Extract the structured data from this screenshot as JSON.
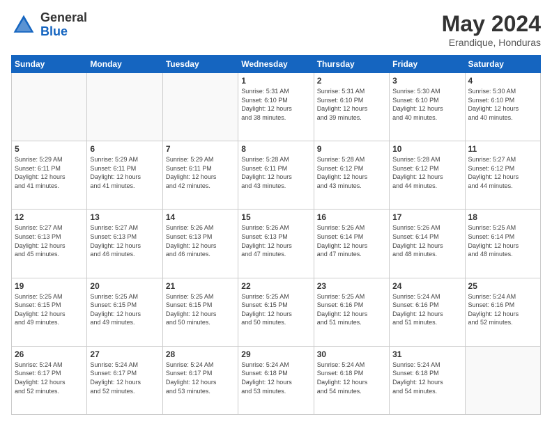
{
  "header": {
    "logo_general": "General",
    "logo_blue": "Blue",
    "month_title": "May 2024",
    "location": "Erandique, Honduras"
  },
  "weekdays": [
    "Sunday",
    "Monday",
    "Tuesday",
    "Wednesday",
    "Thursday",
    "Friday",
    "Saturday"
  ],
  "weeks": [
    [
      {
        "day": "",
        "info": ""
      },
      {
        "day": "",
        "info": ""
      },
      {
        "day": "",
        "info": ""
      },
      {
        "day": "1",
        "info": "Sunrise: 5:31 AM\nSunset: 6:10 PM\nDaylight: 12 hours\nand 38 minutes."
      },
      {
        "day": "2",
        "info": "Sunrise: 5:31 AM\nSunset: 6:10 PM\nDaylight: 12 hours\nand 39 minutes."
      },
      {
        "day": "3",
        "info": "Sunrise: 5:30 AM\nSunset: 6:10 PM\nDaylight: 12 hours\nand 40 minutes."
      },
      {
        "day": "4",
        "info": "Sunrise: 5:30 AM\nSunset: 6:10 PM\nDaylight: 12 hours\nand 40 minutes."
      }
    ],
    [
      {
        "day": "5",
        "info": "Sunrise: 5:29 AM\nSunset: 6:11 PM\nDaylight: 12 hours\nand 41 minutes."
      },
      {
        "day": "6",
        "info": "Sunrise: 5:29 AM\nSunset: 6:11 PM\nDaylight: 12 hours\nand 41 minutes."
      },
      {
        "day": "7",
        "info": "Sunrise: 5:29 AM\nSunset: 6:11 PM\nDaylight: 12 hours\nand 42 minutes."
      },
      {
        "day": "8",
        "info": "Sunrise: 5:28 AM\nSunset: 6:11 PM\nDaylight: 12 hours\nand 43 minutes."
      },
      {
        "day": "9",
        "info": "Sunrise: 5:28 AM\nSunset: 6:12 PM\nDaylight: 12 hours\nand 43 minutes."
      },
      {
        "day": "10",
        "info": "Sunrise: 5:28 AM\nSunset: 6:12 PM\nDaylight: 12 hours\nand 44 minutes."
      },
      {
        "day": "11",
        "info": "Sunrise: 5:27 AM\nSunset: 6:12 PM\nDaylight: 12 hours\nand 44 minutes."
      }
    ],
    [
      {
        "day": "12",
        "info": "Sunrise: 5:27 AM\nSunset: 6:13 PM\nDaylight: 12 hours\nand 45 minutes."
      },
      {
        "day": "13",
        "info": "Sunrise: 5:27 AM\nSunset: 6:13 PM\nDaylight: 12 hours\nand 46 minutes."
      },
      {
        "day": "14",
        "info": "Sunrise: 5:26 AM\nSunset: 6:13 PM\nDaylight: 12 hours\nand 46 minutes."
      },
      {
        "day": "15",
        "info": "Sunrise: 5:26 AM\nSunset: 6:13 PM\nDaylight: 12 hours\nand 47 minutes."
      },
      {
        "day": "16",
        "info": "Sunrise: 5:26 AM\nSunset: 6:14 PM\nDaylight: 12 hours\nand 47 minutes."
      },
      {
        "day": "17",
        "info": "Sunrise: 5:26 AM\nSunset: 6:14 PM\nDaylight: 12 hours\nand 48 minutes."
      },
      {
        "day": "18",
        "info": "Sunrise: 5:25 AM\nSunset: 6:14 PM\nDaylight: 12 hours\nand 48 minutes."
      }
    ],
    [
      {
        "day": "19",
        "info": "Sunrise: 5:25 AM\nSunset: 6:15 PM\nDaylight: 12 hours\nand 49 minutes."
      },
      {
        "day": "20",
        "info": "Sunrise: 5:25 AM\nSunset: 6:15 PM\nDaylight: 12 hours\nand 49 minutes."
      },
      {
        "day": "21",
        "info": "Sunrise: 5:25 AM\nSunset: 6:15 PM\nDaylight: 12 hours\nand 50 minutes."
      },
      {
        "day": "22",
        "info": "Sunrise: 5:25 AM\nSunset: 6:15 PM\nDaylight: 12 hours\nand 50 minutes."
      },
      {
        "day": "23",
        "info": "Sunrise: 5:25 AM\nSunset: 6:16 PM\nDaylight: 12 hours\nand 51 minutes."
      },
      {
        "day": "24",
        "info": "Sunrise: 5:24 AM\nSunset: 6:16 PM\nDaylight: 12 hours\nand 51 minutes."
      },
      {
        "day": "25",
        "info": "Sunrise: 5:24 AM\nSunset: 6:16 PM\nDaylight: 12 hours\nand 52 minutes."
      }
    ],
    [
      {
        "day": "26",
        "info": "Sunrise: 5:24 AM\nSunset: 6:17 PM\nDaylight: 12 hours\nand 52 minutes."
      },
      {
        "day": "27",
        "info": "Sunrise: 5:24 AM\nSunset: 6:17 PM\nDaylight: 12 hours\nand 52 minutes."
      },
      {
        "day": "28",
        "info": "Sunrise: 5:24 AM\nSunset: 6:17 PM\nDaylight: 12 hours\nand 53 minutes."
      },
      {
        "day": "29",
        "info": "Sunrise: 5:24 AM\nSunset: 6:18 PM\nDaylight: 12 hours\nand 53 minutes."
      },
      {
        "day": "30",
        "info": "Sunrise: 5:24 AM\nSunset: 6:18 PM\nDaylight: 12 hours\nand 54 minutes."
      },
      {
        "day": "31",
        "info": "Sunrise: 5:24 AM\nSunset: 6:18 PM\nDaylight: 12 hours\nand 54 minutes."
      },
      {
        "day": "",
        "info": ""
      }
    ]
  ]
}
